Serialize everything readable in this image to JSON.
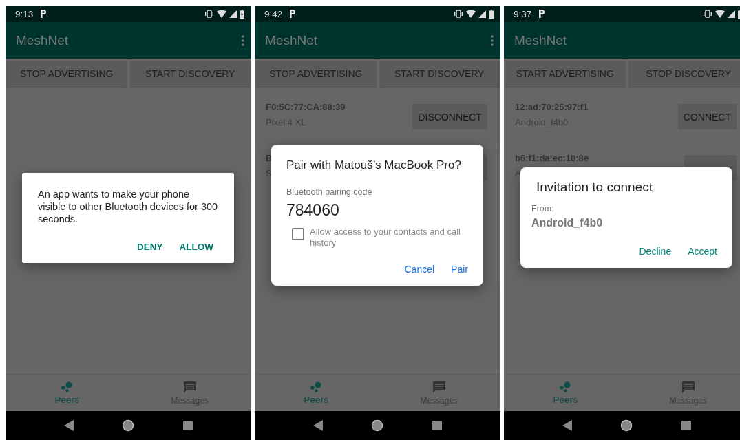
{
  "phones": [
    {
      "status_time": "9:13",
      "battery_charging": true,
      "app_title": "MeshNet",
      "buttons": [
        "STOP ADVERTISING",
        "START DISCOVERY"
      ],
      "dialog": {
        "kind": "message",
        "text": "An app wants to make your phone visible to other Bluetooth devices for 300 seconds.",
        "actions": [
          "DENY",
          "ALLOW"
        ]
      },
      "bottom_nav": [
        {
          "label": "Peers",
          "selected": true
        },
        {
          "label": "Messages",
          "selected": false
        }
      ]
    },
    {
      "status_time": "9:42",
      "battery_charging": false,
      "app_title": "MeshNet",
      "buttons": [
        "STOP ADVERTISING",
        "START DISCOVERY"
      ],
      "peers": [
        {
          "address": "F0:5C:77:CA:88:39",
          "name": "Pixel 4 XL",
          "action": "DISCONNECT"
        },
        {
          "address": "B",
          "name": "S"
        }
      ],
      "dialog": {
        "kind": "pairing",
        "title": "Pair with Matouš’s MacBook Pro?",
        "label": "Bluetooth pairing code",
        "code": "784060",
        "checkbox": {
          "label": "Allow access to your contacts and call history",
          "checked": false
        },
        "actions": [
          "Cancel",
          "Pair"
        ]
      },
      "bottom_nav": [
        {
          "label": "Peers",
          "selected": true
        },
        {
          "label": "Messages",
          "selected": false
        }
      ]
    },
    {
      "status_time": "9:37",
      "battery_charging": false,
      "app_title": "MeshNet",
      "buttons": [
        "START ADVERTISING",
        "STOP DISCOVERY"
      ],
      "peers": [
        {
          "address": "12:ad:70:25:97:f1",
          "name": "Android_f4b0",
          "action": "CONNECT"
        },
        {
          "address": "b6:f1:da:ec:10:8e",
          "name": "A"
        }
      ],
      "dialog": {
        "kind": "invitation",
        "title": "Invitation to connect",
        "from_label": "From:",
        "from_name": "Android_f4b0",
        "actions": [
          "Decline",
          "Accept"
        ]
      },
      "bottom_nav": [
        {
          "label": "Peers",
          "selected": true
        },
        {
          "label": "Messages",
          "selected": false
        }
      ]
    }
  ]
}
